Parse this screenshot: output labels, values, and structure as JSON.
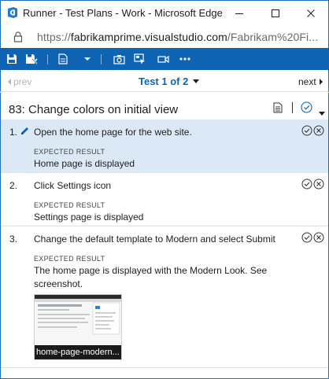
{
  "window": {
    "title": "Runner - Test Plans - Work - Microsoft Edge",
    "minimize_glyph": "—",
    "maximize_glyph": "☐",
    "close_glyph": "✕"
  },
  "address": {
    "scheme": "https://",
    "host": "fabrikamprime.visualstudio.com",
    "path": "/Fabrikam%20Fi..."
  },
  "toolbar": {
    "icons": [
      "save-icon",
      "save-and-close-icon",
      "new-bug-icon",
      "dropdown-arrow-icon",
      "capture-screenshot-icon",
      "capture-user-actions-icon",
      "record-screen-icon",
      "more-options-icon"
    ]
  },
  "nav": {
    "prev_label": "prev",
    "test_label": "Test 1 of 2",
    "next_label": "next"
  },
  "test_case": {
    "title": "83: Change colors on initial view"
  },
  "colors": {
    "accent": "#0f63b3",
    "active_row": "#dbe9f7"
  },
  "steps": [
    {
      "number": "1.",
      "action": "Open the home page for the web site.",
      "expected_label": "EXPECTED RESULT",
      "expected": "Home page is displayed"
    },
    {
      "number": "2.",
      "action": "Click Settings icon",
      "expected_label": "EXPECTED RESULT",
      "expected": "Settings page is displayed"
    },
    {
      "number": "3.",
      "action": "Change the default template to Modern and select Submit",
      "expected_label": "EXPECTED RESULT",
      "expected": "The home page is displayed with the Modern Look. See screenshot.",
      "attachment_name": "home-page-modern..."
    }
  ]
}
